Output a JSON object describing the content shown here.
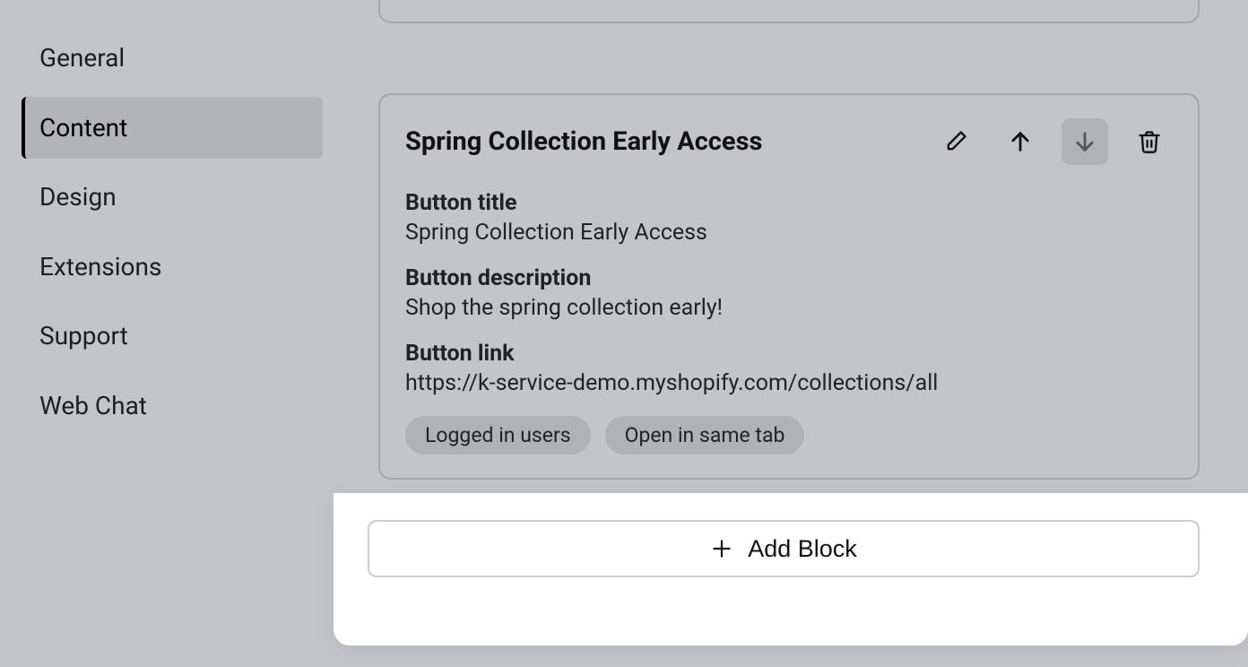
{
  "sidebar": {
    "items": [
      {
        "label": "General"
      },
      {
        "label": "Content"
      },
      {
        "label": "Design"
      },
      {
        "label": "Extensions"
      },
      {
        "label": "Support"
      },
      {
        "label": "Web Chat"
      }
    ],
    "activeIndex": 1
  },
  "block": {
    "title": "Spring Collection Early Access",
    "fields": {
      "button_title_label": "Button title",
      "button_title_value": "Spring Collection Early Access",
      "button_description_label": "Button description",
      "button_description_value": "Shop the spring collection early!",
      "button_link_label": "Button link",
      "button_link_value": "https://k-service-demo.myshopify.com/collections/all"
    },
    "tags": [
      "Logged in users",
      "Open in same tab"
    ]
  },
  "actions": {
    "add_block": "Add Block"
  }
}
